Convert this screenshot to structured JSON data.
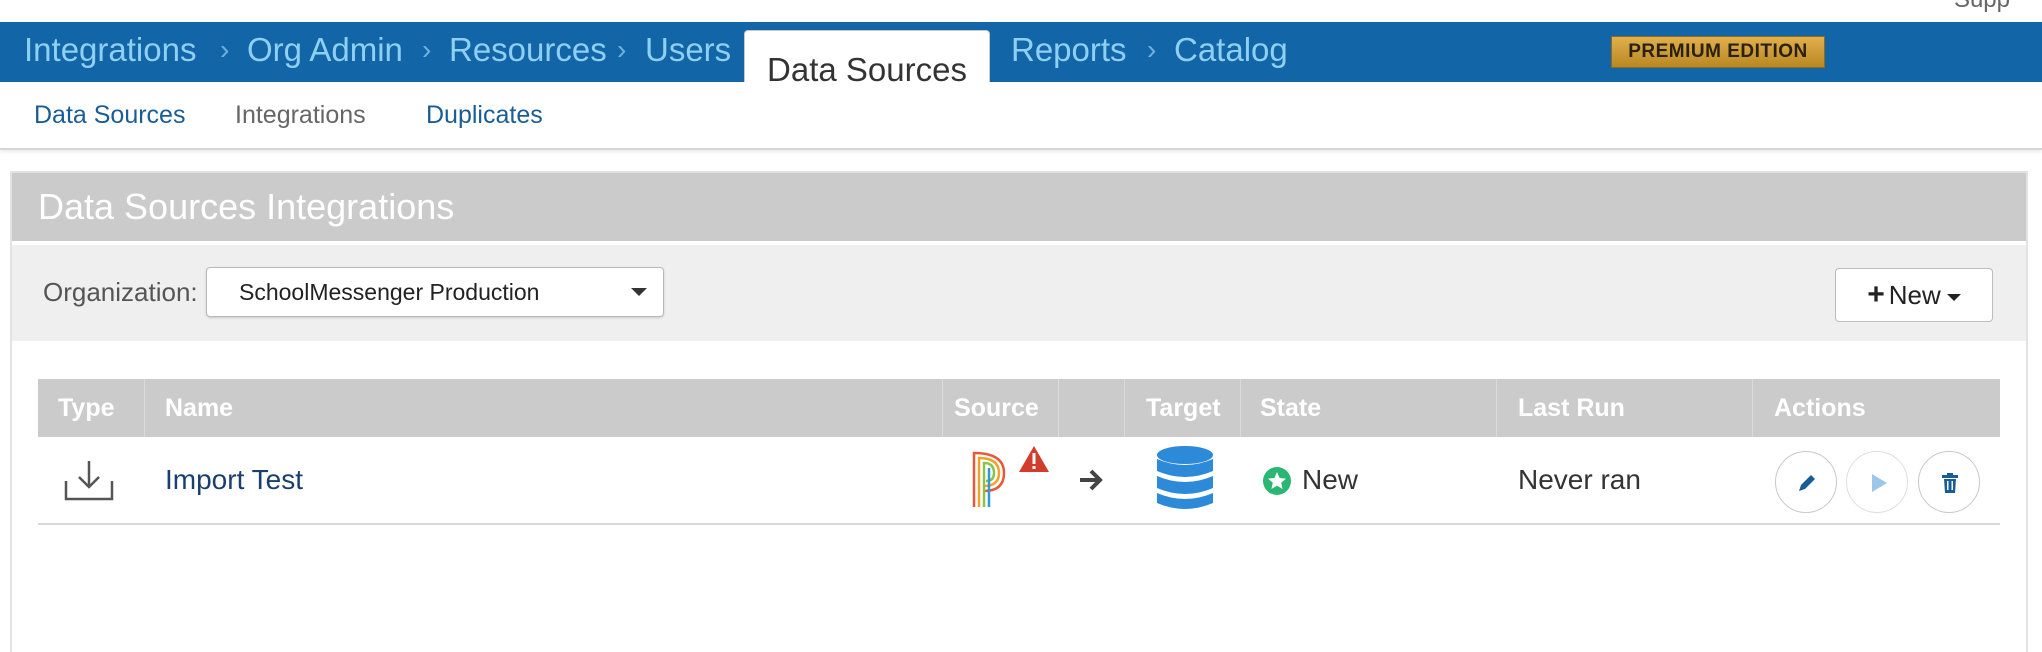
{
  "nav": {
    "items": [
      {
        "label": "Integrations"
      },
      {
        "label": "Org Admin"
      },
      {
        "label": "Resources"
      },
      {
        "label": "Users"
      },
      {
        "label": "Data Sources",
        "active": true
      },
      {
        "label": "Reports"
      },
      {
        "label": "Catalog"
      }
    ],
    "separator": "›",
    "premium_badge": "PREMIUM EDITION",
    "corner_text": "Supp"
  },
  "subnav": {
    "items": [
      {
        "label": "Data Sources"
      },
      {
        "label": "Integrations"
      },
      {
        "label": "Duplicates"
      }
    ]
  },
  "panel": {
    "title": "Data Sources Integrations",
    "org_label": "Organization:",
    "org_value": "SchoolMessenger Production",
    "new_button": "New"
  },
  "table": {
    "headers": [
      "Type",
      "Name",
      "Source",
      "",
      "Target",
      "State",
      "Last Run",
      "Actions"
    ],
    "rows": [
      {
        "type_icon": "download-icon",
        "name": "Import Test",
        "source_icon": "powerschool-logo",
        "source_alert_icon": "warning-icon",
        "arrow_icon": "arrow-right-icon",
        "target_icon": "database-icon",
        "state_icon": "star-circle-icon",
        "state": "New",
        "last_run": "Never ran",
        "actions": [
          "edit-icon",
          "play-icon",
          "trash-icon"
        ]
      }
    ]
  },
  "colors": {
    "nav_bg": "#1266a8",
    "nav_link": "#8fd0f2",
    "sub_link": "#1a5d96",
    "state_new": "#2bb673",
    "database": "#2c8ad8",
    "warning": "#d33b2b"
  }
}
